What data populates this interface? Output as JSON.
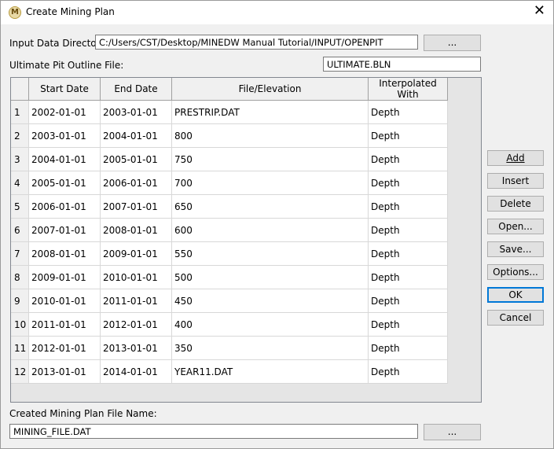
{
  "window": {
    "title": "Create Mining Plan",
    "close_glyph": "✕",
    "app_icon": "M"
  },
  "input_dir": {
    "label": "Input Data Directory:",
    "value": "C:/Users/CST/Desktop/MINEDW Manual Tutorial/INPUT/OPENPIT",
    "browse_label": "..."
  },
  "pit_outline": {
    "label": "Ultimate Pit Outline File:",
    "value": "ULTIMATE.BLN"
  },
  "grid": {
    "columns": [
      "Start Date",
      "End Date",
      "File/Elevation",
      "Interpolated With"
    ],
    "rows": [
      {
        "n": "1",
        "start": "2002-01-01",
        "end": "2003-01-01",
        "file": "PRESTRIP.DAT",
        "interp": "Depth"
      },
      {
        "n": "2",
        "start": "2003-01-01",
        "end": "2004-01-01",
        "file": "800",
        "interp": "Depth"
      },
      {
        "n": "3",
        "start": "2004-01-01",
        "end": "2005-01-01",
        "file": "750",
        "interp": "Depth"
      },
      {
        "n": "4",
        "start": "2005-01-01",
        "end": "2006-01-01",
        "file": "700",
        "interp": "Depth"
      },
      {
        "n": "5",
        "start": "2006-01-01",
        "end": "2007-01-01",
        "file": "650",
        "interp": "Depth"
      },
      {
        "n": "6",
        "start": "2007-01-01",
        "end": "2008-01-01",
        "file": "600",
        "interp": "Depth"
      },
      {
        "n": "7",
        "start": "2008-01-01",
        "end": "2009-01-01",
        "file": "550",
        "interp": "Depth"
      },
      {
        "n": "8",
        "start": "2009-01-01",
        "end": "2010-01-01",
        "file": "500",
        "interp": "Depth"
      },
      {
        "n": "9",
        "start": "2010-01-01",
        "end": "2011-01-01",
        "file": "450",
        "interp": "Depth"
      },
      {
        "n": "10",
        "start": "2011-01-01",
        "end": "2012-01-01",
        "file": "400",
        "interp": "Depth"
      },
      {
        "n": "11",
        "start": "2012-01-01",
        "end": "2013-01-01",
        "file": "350",
        "interp": "Depth"
      },
      {
        "n": "12",
        "start": "2013-01-01",
        "end": "2014-01-01",
        "file": "YEAR11.DAT",
        "interp": "Depth"
      }
    ]
  },
  "buttons": {
    "add": "Add",
    "insert": "Insert",
    "delete": "Delete",
    "open": "Open...",
    "save": "Save...",
    "options": "Options...",
    "ok": "OK",
    "cancel": "Cancel"
  },
  "output_file": {
    "label": "Created Mining Plan File Name:",
    "value": "MINING_FILE.DAT",
    "browse_label": "..."
  }
}
